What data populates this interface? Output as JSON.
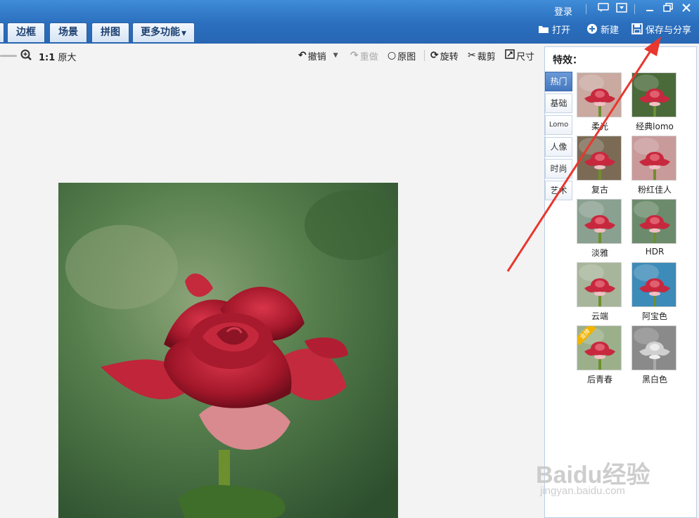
{
  "window": {
    "login": "登录",
    "controls": [
      "comment-icon",
      "dropdown-icon",
      "minimize-icon",
      "restore-icon",
      "close-icon"
    ]
  },
  "tabs": [
    {
      "label": "边框"
    },
    {
      "label": "场景"
    },
    {
      "label": "拼图"
    },
    {
      "label": "更多功能",
      "has_caret": true
    }
  ],
  "actions": {
    "open": "打开",
    "new": "新建",
    "save_share": "保存与分享"
  },
  "toolbar": {
    "one_one": "1:1",
    "original_size": "原大",
    "undo": "撤销",
    "redo": "重做",
    "original": "原图",
    "rotate": "旋转",
    "crop": "裁剪",
    "size": "尺寸"
  },
  "panel": {
    "title": "特效：",
    "categories": [
      "热门",
      "基础",
      "Lomo",
      "人像",
      "时尚",
      "艺术"
    ],
    "active_category": "热门",
    "effects": [
      {
        "label": "柔光",
        "tint": "#c9a9a0"
      },
      {
        "label": "经典lomo",
        "tint": "#4a6a3a"
      },
      {
        "label": "复古",
        "tint": "#7b6b55"
      },
      {
        "label": "粉红佳人",
        "tint": "#c99a9a"
      },
      {
        "label": "淡雅",
        "tint": "#8aa090"
      },
      {
        "label": "HDR",
        "tint": "#6c8b6c"
      },
      {
        "label": "云端",
        "tint": "#a7b59a"
      },
      {
        "label": "阿宝色",
        "tint": "#3d8bb8"
      },
      {
        "label": "后青春",
        "tint": "#9bb08a",
        "badge": "金牌"
      },
      {
        "label": "黑白色",
        "tint": "#8a8a8a",
        "grayscale": true
      }
    ]
  },
  "watermark": {
    "brand": "Baidu经验",
    "url": "jingyan.baidu.com"
  },
  "colors": {
    "titlebar": "#2a6fbe",
    "arrow": "#e8372e",
    "active_tab": "#4577bf"
  }
}
